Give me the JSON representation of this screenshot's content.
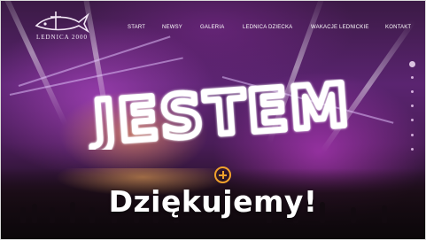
{
  "logo": {
    "text": "LEDNICA 2000"
  },
  "nav": {
    "items": [
      {
        "label": "START"
      },
      {
        "label": "NEWSY"
      },
      {
        "label": "GALERIA"
      },
      {
        "label": "LEDNICA DZIECKA"
      },
      {
        "label": "WAKACJE LEDNICKIE"
      },
      {
        "label": "KONTAKT"
      }
    ]
  },
  "hero": {
    "title": "JESTEM",
    "subtitle": "Dziękujemy!"
  },
  "slider": {
    "count": 7,
    "active_index": 0
  },
  "colors": {
    "accent": "#f2a22c",
    "overlay": "#5a2470",
    "text": "#ffffff"
  },
  "icons": {
    "plus": "plus-circle-icon",
    "slider": "slider-dot-icon"
  }
}
